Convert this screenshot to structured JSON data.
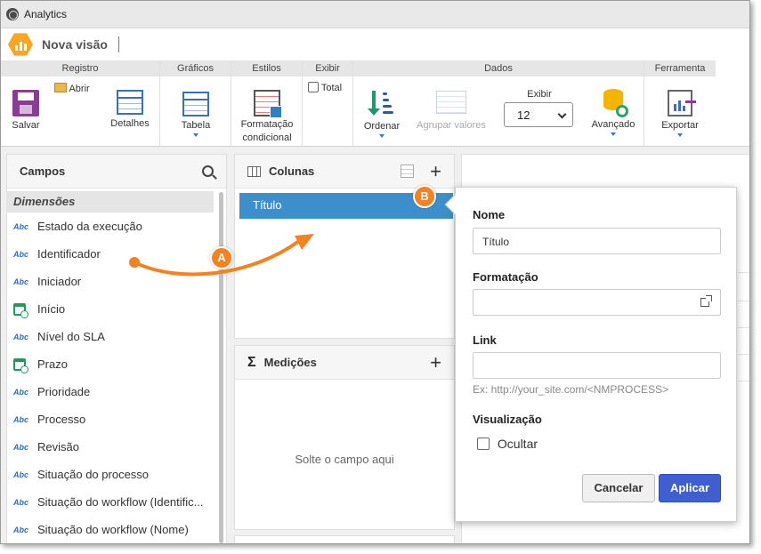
{
  "window": {
    "title": "Analytics"
  },
  "header": {
    "view_title": "Nova visão"
  },
  "ribbon": {
    "groups": {
      "registro": "Registro",
      "graficos": "Gráficos",
      "estilos": "Estilos",
      "exibir": "Exibir",
      "dados": "Dados",
      "ferramenta": "Ferramenta"
    },
    "salvar": "Salvar",
    "abrir": "Abrir",
    "detalhes": "Detalhes",
    "tabela": "Tabela",
    "formatacao_1": "Formatação",
    "formatacao_2": "condicional",
    "total": "Total",
    "ordenar": "Ordenar",
    "agrupar": "Agrupar valores",
    "exibir_label": "Exibir",
    "exibir_value": "12",
    "avancado": "Avançado",
    "exportar": "Exportar"
  },
  "campos": {
    "title": "Campos",
    "category": "Dimensões",
    "fields": [
      {
        "type": "Abc",
        "label": "Estado da execução"
      },
      {
        "type": "Abc",
        "label": "Identificador"
      },
      {
        "type": "Abc",
        "label": "Iniciador"
      },
      {
        "type": "date",
        "label": "Início"
      },
      {
        "type": "Abc",
        "label": "Nível do SLA"
      },
      {
        "type": "date",
        "label": "Prazo"
      },
      {
        "type": "Abc",
        "label": "Prioridade"
      },
      {
        "type": "Abc",
        "label": "Processo"
      },
      {
        "type": "Abc",
        "label": "Revisão"
      },
      {
        "type": "Abc",
        "label": "Situação do processo"
      },
      {
        "type": "Abc",
        "label": "Situação do workflow (Identific..."
      },
      {
        "type": "Abc",
        "label": "Situação do workflow (Nome)"
      }
    ]
  },
  "colunas": {
    "title": "Colunas",
    "item": "Título"
  },
  "medicoes": {
    "title": "Medições",
    "drop_text": "Solte o campo aqui"
  },
  "popover": {
    "nome_label": "Nome",
    "nome_value": "Título",
    "formatacao_label": "Formatação",
    "formatacao_value": "",
    "link_label": "Link",
    "link_value": "",
    "link_hint": "Ex: http://your_site.com/<NMPROCESS>",
    "visualizacao_label": "Visualização",
    "ocultar_label": "Ocultar",
    "ocultar_checked": false,
    "cancel": "Cancelar",
    "apply": "Aplicar"
  },
  "annotations": {
    "a": "A",
    "b": "B",
    "color": "#f58220"
  },
  "colors": {
    "accent": "#3d8fcc",
    "apply": "#3f5fd0",
    "logo": "#f6a623"
  }
}
